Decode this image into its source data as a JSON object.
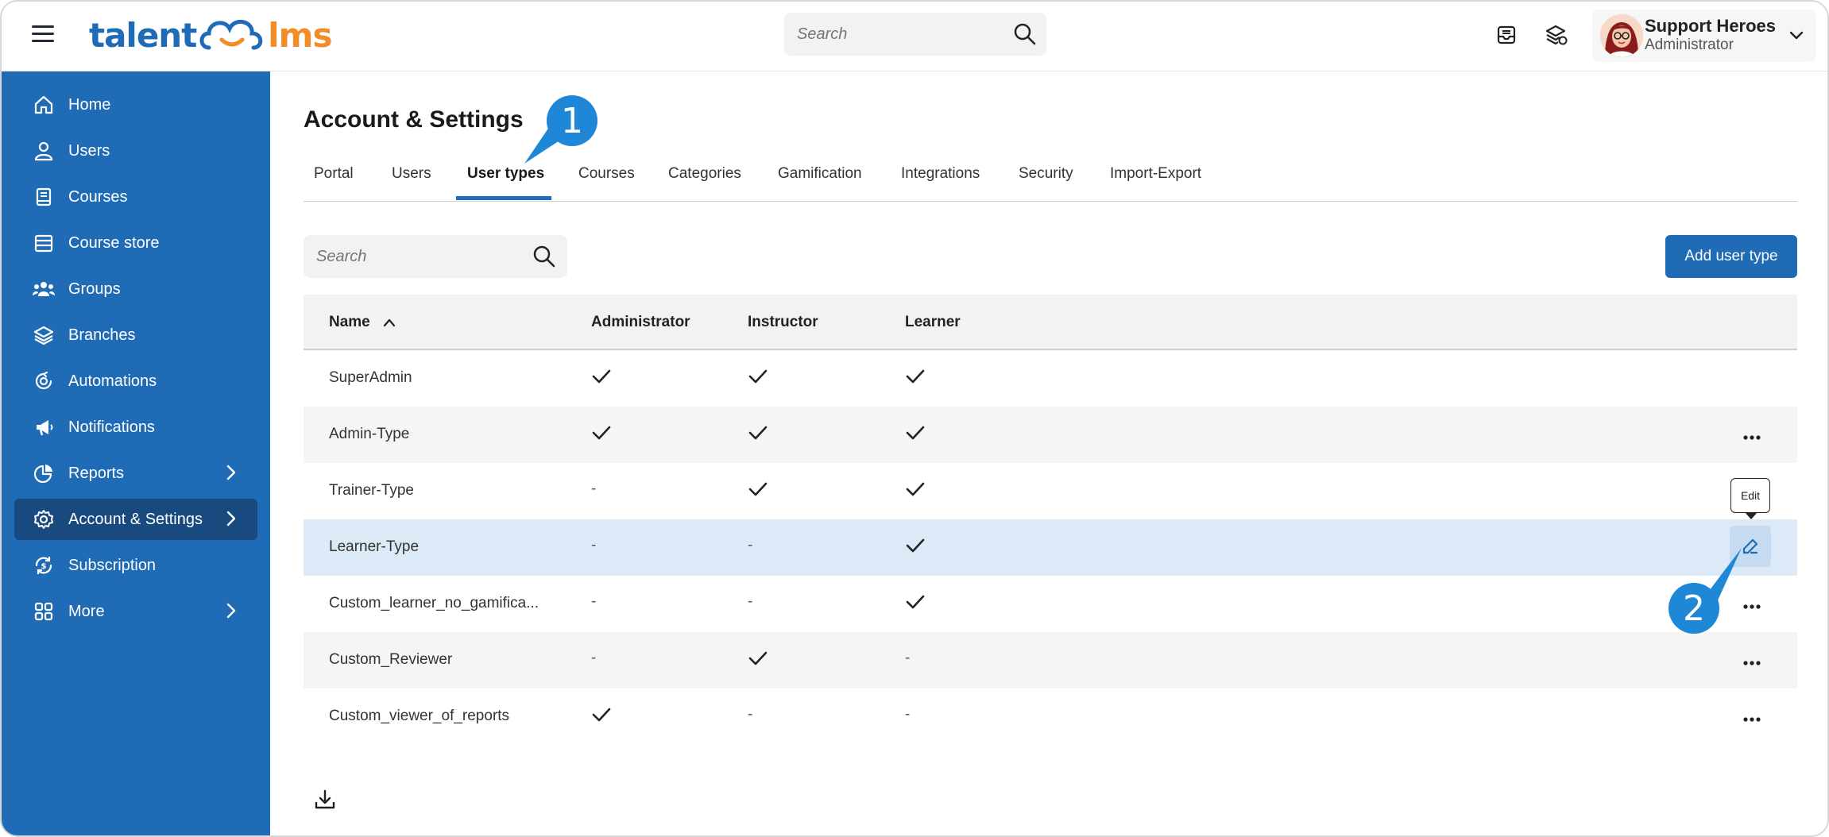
{
  "header": {
    "logo": {
      "part1": "talent",
      "part2": "lms"
    },
    "search": {
      "placeholder": "Search"
    },
    "user": {
      "name": "Support Heroes",
      "role": "Administrator"
    }
  },
  "sidebar": {
    "items": [
      {
        "label": "Home",
        "icon": "home-icon"
      },
      {
        "label": "Users",
        "icon": "user-icon"
      },
      {
        "label": "Courses",
        "icon": "book-icon"
      },
      {
        "label": "Course store",
        "icon": "store-icon"
      },
      {
        "label": "Groups",
        "icon": "groups-icon"
      },
      {
        "label": "Branches",
        "icon": "layers-icon"
      },
      {
        "label": "Automations",
        "icon": "automation-icon"
      },
      {
        "label": "Notifications",
        "icon": "megaphone-icon"
      },
      {
        "label": "Reports",
        "icon": "pie-chart-icon"
      },
      {
        "label": "Account & Settings",
        "icon": "gear-icon"
      },
      {
        "label": "Subscription",
        "icon": "subscription-icon"
      },
      {
        "label": "More",
        "icon": "grid-icon"
      }
    ]
  },
  "main": {
    "title": "Account & Settings",
    "tabs": [
      "Portal",
      "Users",
      "User types",
      "Courses",
      "Categories",
      "Gamification",
      "Integrations",
      "Security",
      "Import-Export"
    ],
    "active_tab": "User types",
    "search": {
      "placeholder": "Search"
    },
    "add_button": "Add user type",
    "table": {
      "headers": [
        "Name",
        "Administrator",
        "Instructor",
        "Learner"
      ],
      "rows": [
        {
          "name": "SuperAdmin",
          "administrator": "check",
          "instructor": "check",
          "learner": "check"
        },
        {
          "name": "Admin-Type",
          "administrator": "check",
          "instructor": "check",
          "learner": "check"
        },
        {
          "name": "Trainer-Type",
          "administrator": "-",
          "instructor": "check",
          "learner": "check"
        },
        {
          "name": "Learner-Type",
          "administrator": "-",
          "instructor": "-",
          "learner": "check"
        },
        {
          "name": "Custom_learner_no_gamifica...",
          "administrator": "-",
          "instructor": "-",
          "learner": "check"
        },
        {
          "name": "Custom_Reviewer",
          "administrator": "-",
          "instructor": "check",
          "learner": "-"
        },
        {
          "name": "Custom_viewer_of_reports",
          "administrator": "check",
          "instructor": "-",
          "learner": "-"
        }
      ]
    },
    "tooltip": "Edit",
    "dash": "-"
  },
  "callouts": [
    "1",
    "2"
  ],
  "colors": {
    "brand_blue": "#1f6bb6",
    "brand_orange": "#f28c28",
    "callout_blue": "#1e88d6",
    "row_highlight": "#dce9f7"
  }
}
